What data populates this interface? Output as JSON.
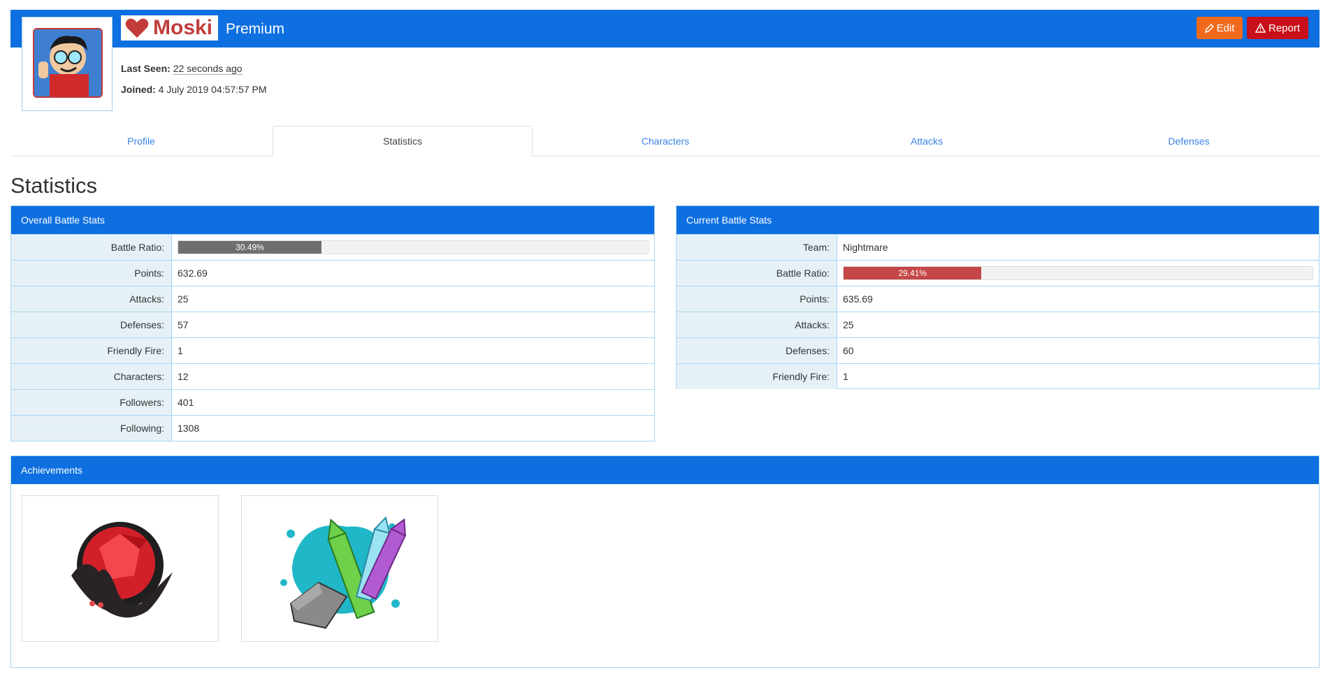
{
  "user": {
    "name": "Moski",
    "tier": "Premium",
    "last_seen_label": "Last Seen:",
    "last_seen_value": "22 seconds ago",
    "joined_label": "Joined:",
    "joined_value": "4 July 2019 04:57:57 PM"
  },
  "actions": {
    "edit_label": "Edit",
    "report_label": "Report"
  },
  "tabs": [
    {
      "label": "Profile",
      "active": false
    },
    {
      "label": "Statistics",
      "active": true
    },
    {
      "label": "Characters",
      "active": false
    },
    {
      "label": "Attacks",
      "active": false
    },
    {
      "label": "Defenses",
      "active": false
    }
  ],
  "page_title": "Statistics",
  "overall": {
    "title": "Overall Battle Stats",
    "battle_ratio_label": "Battle Ratio:",
    "battle_ratio_text": "30.49%",
    "battle_ratio_value": 30.49,
    "rows": [
      {
        "label": "Points:",
        "value": "632.69"
      },
      {
        "label": "Attacks:",
        "value": "25"
      },
      {
        "label": "Defenses:",
        "value": "57"
      },
      {
        "label": "Friendly Fire:",
        "value": "1"
      },
      {
        "label": "Characters:",
        "value": "12"
      },
      {
        "label": "Followers:",
        "value": "401"
      },
      {
        "label": "Following:",
        "value": "1308"
      }
    ]
  },
  "current": {
    "title": "Current Battle Stats",
    "team_label": "Team:",
    "team_value": "Nightmare",
    "battle_ratio_label": "Battle Ratio:",
    "battle_ratio_text": "29.41%",
    "battle_ratio_value": 29.41,
    "rows": [
      {
        "label": "Points:",
        "value": "635.69"
      },
      {
        "label": "Attacks:",
        "value": "25"
      },
      {
        "label": "Defenses:",
        "value": "60"
      },
      {
        "label": "Friendly Fire:",
        "value": "1"
      }
    ]
  },
  "achievements": {
    "title": "Achievements",
    "items": [
      {
        "icon": "nightmare-bat-badge-icon"
      },
      {
        "icon": "crayons-badge-icon"
      }
    ]
  },
  "colors": {
    "header_blue": "#0d6fe0",
    "edit_orange": "#f06a1e",
    "report_red": "#c8101a",
    "overall_bar": "#6f6f6f",
    "current_bar": "#c54646",
    "name_red": "#c23c3c"
  }
}
